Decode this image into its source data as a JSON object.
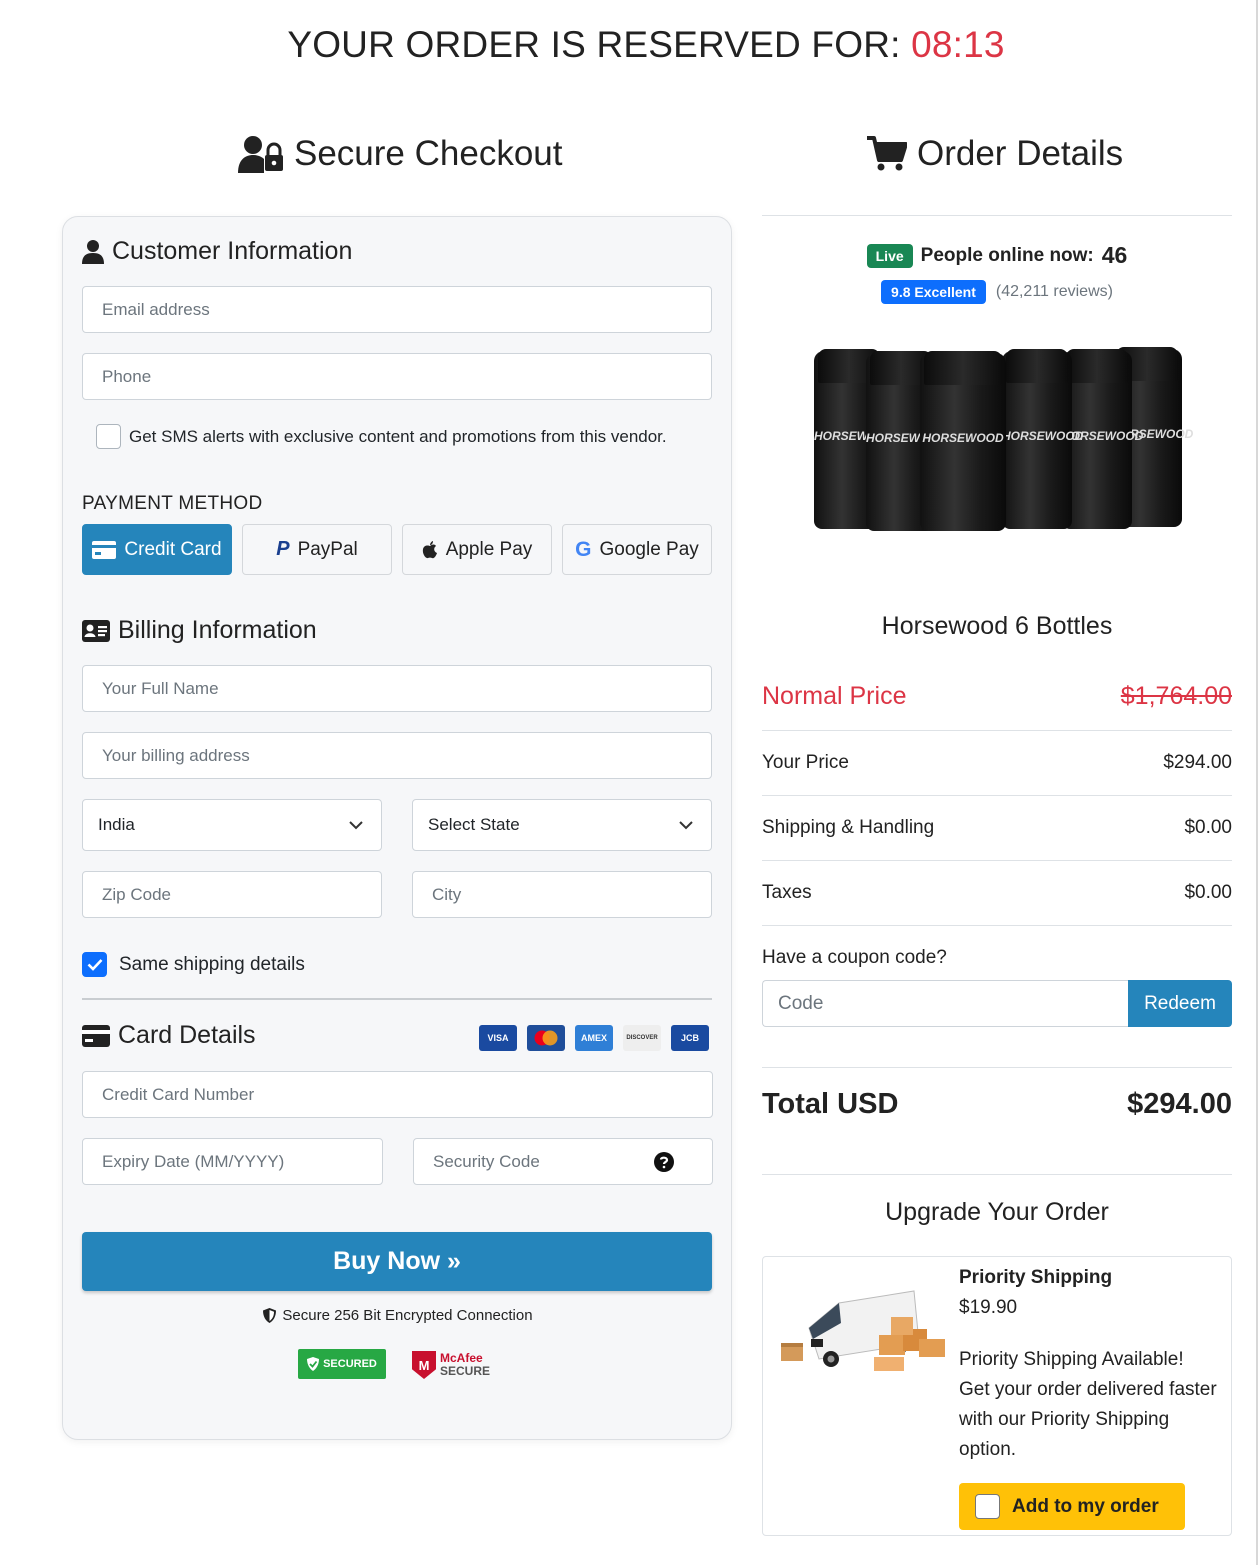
{
  "timer": {
    "label": "YOUR ORDER IS RESERVED FOR:",
    "time": "08:13"
  },
  "checkout": {
    "title": "Secure Checkout",
    "customer": {
      "title": "Customer Information",
      "email_placeholder": "Email address",
      "phone_placeholder": "Phone",
      "sms_label": "Get SMS alerts with exclusive content and promotions from this vendor."
    },
    "payment": {
      "label": "PAYMENT METHOD",
      "methods": [
        "Credit Card",
        "PayPal",
        "Apple Pay",
        "Google Pay"
      ],
      "active": "Credit Card"
    },
    "billing": {
      "title": "Billing Information",
      "name_placeholder": "Your Full Name",
      "address_placeholder": "Your billing address",
      "country": "India",
      "state": "Select State",
      "zip_placeholder": "Zip Code",
      "city_placeholder": "City",
      "same_shipping": "Same shipping details"
    },
    "card": {
      "title": "Card Details",
      "brands": [
        "VISA",
        "MC",
        "AMEX",
        "DISCOVER",
        "JCB"
      ],
      "number_placeholder": "Credit Card Number",
      "expiry_placeholder": "Expiry Date (MM/YYYY)",
      "cvv_placeholder": "Security Code"
    },
    "buy_label": "Buy Now »",
    "secure_text": "Secure 256 Bit Encrypted Connection",
    "trust_badge": "SECURED",
    "mcafee_line1": "McAfee",
    "mcafee_line2": "SECURE"
  },
  "order": {
    "title": "Order Details",
    "live": "Live",
    "online_label": "People online now:",
    "online_count": "46",
    "rating_badge": "9.8 Excellent",
    "reviews": "(42,211 reviews)",
    "bottle_label": "HORSEWOOD",
    "product_name": "Horsewood 6 Bottles",
    "rows": [
      {
        "label": "Normal Price",
        "value": "$1,764.00"
      },
      {
        "label": "Your Price",
        "value": "$294.00"
      },
      {
        "label": "Shipping & Handling",
        "value": "$0.00"
      },
      {
        "label": "Taxes",
        "value": "$0.00"
      }
    ],
    "coupon_label": "Have a coupon code?",
    "coupon_placeholder": "Code",
    "redeem_label": "Redeem",
    "total_label": "Total USD",
    "total_value": "$294.00",
    "upgrade_title": "Upgrade Your Order",
    "upsell": {
      "title": "Priority Shipping",
      "price": "$19.90",
      "description": "Priority Shipping Available! Get your order delivered faster with our Priority Shipping option.",
      "button": "Add to my order"
    }
  },
  "colors": {
    "accent": "#2585bb",
    "danger": "#dc3545",
    "success": "#198754",
    "primary": "#0d6efd",
    "warning": "#ffc107"
  }
}
